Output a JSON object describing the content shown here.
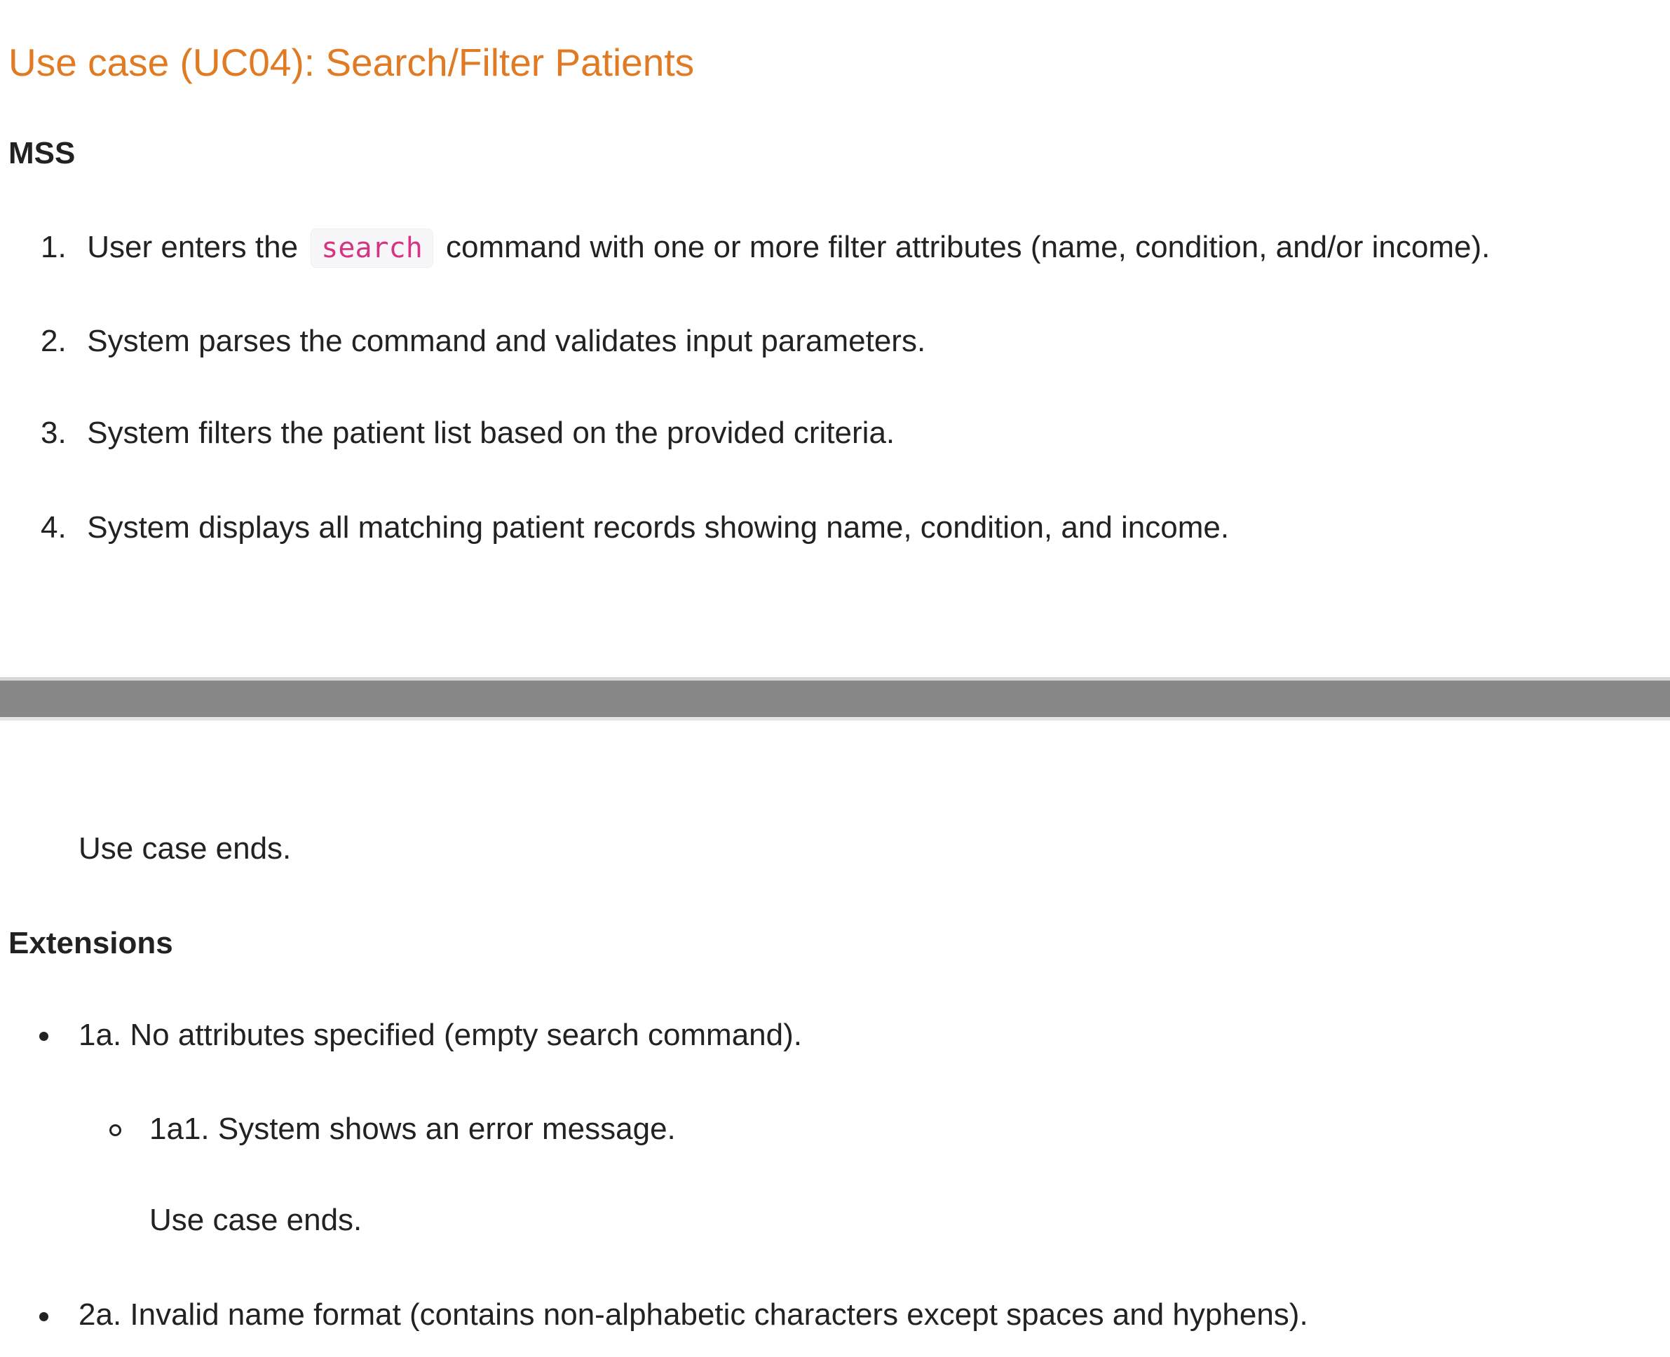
{
  "title": "Use case (UC04): Search/Filter Patients",
  "mss": {
    "heading": "MSS",
    "steps": [
      {
        "number": "1.",
        "text_before": "User enters the",
        "code": "search",
        "text_after": "command with one or more filter attributes (name, condition, and/or income)."
      },
      {
        "number": "2.",
        "text": "System parses the command and validates input parameters."
      },
      {
        "number": "3.",
        "text": "System filters the patient list based on the provided criteria."
      },
      {
        "number": "4.",
        "text": "System displays all matching patient records showing name, condition, and income."
      }
    ],
    "ends": "Use case ends."
  },
  "extensions": {
    "heading": "Extensions",
    "items": [
      {
        "text": "1a. No attributes specified (empty search command).",
        "sub_items": [
          {
            "text": "1a1. System shows an error message.",
            "ends": "Use case ends."
          }
        ]
      },
      {
        "text": "2a. Invalid name format (contains non-alphabetic characters except spaces and hyphens)."
      }
    ]
  },
  "colors": {
    "title": "#e07b24",
    "code_text": "#d63384",
    "code_bg": "#f7f7f9",
    "divider": "#878787",
    "body_text": "#222222"
  }
}
